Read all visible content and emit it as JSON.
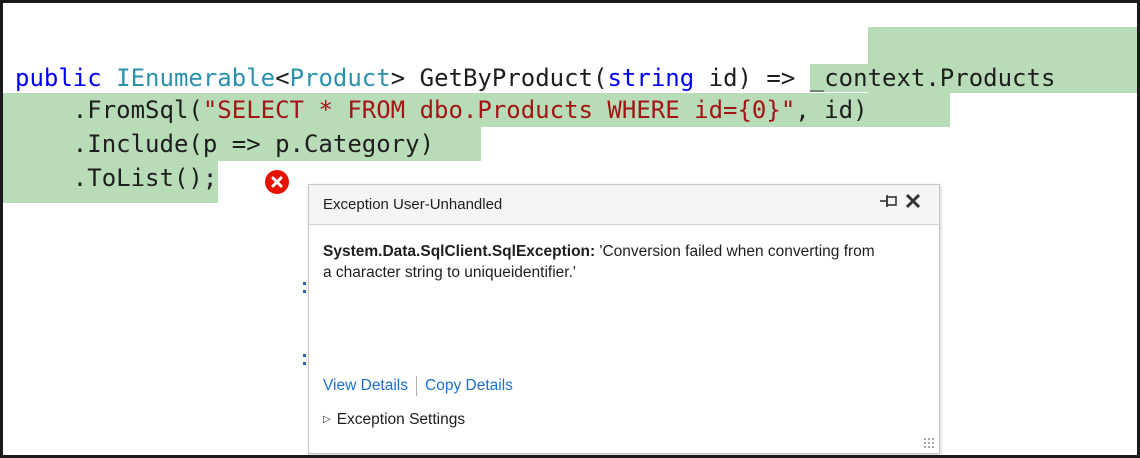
{
  "code": {
    "line1": {
      "kw_public": "public",
      "type_ienumerable": "IEnumerable",
      "lt": "<",
      "type_product": "Product",
      "method": "> GetByProduct(",
      "kw_string": "string",
      "rest": " id) => ",
      "highlighted": "_context.Products"
    },
    "line2": {
      "pre": ".FromSql(",
      "str": "\"SELECT * FROM dbo.Products WHERE id={0}\"",
      "post": ", id)"
    },
    "line3": {
      "text": ".Include(p => p.Category)"
    },
    "line4": {
      "text": ".ToList();"
    }
  },
  "error_icon": "error-circle-x-icon",
  "popup": {
    "title": "Exception User-Unhandled",
    "pin_icon": "pin-icon",
    "close_icon": "close-icon",
    "exception_type": "System.Data.SqlClient.SqlException:",
    "message": " 'Conversion failed when converting from a character string to uniqueidentifier.'",
    "view_details": "View Details",
    "copy_details": "Copy Details",
    "exception_settings": "Exception Settings"
  },
  "colors": {
    "highlight": "#b8dbb8",
    "keyword": "#0000ff",
    "type": "#2b91af",
    "string": "#a31515",
    "link": "#1a6fcf",
    "error": "#e51400"
  }
}
